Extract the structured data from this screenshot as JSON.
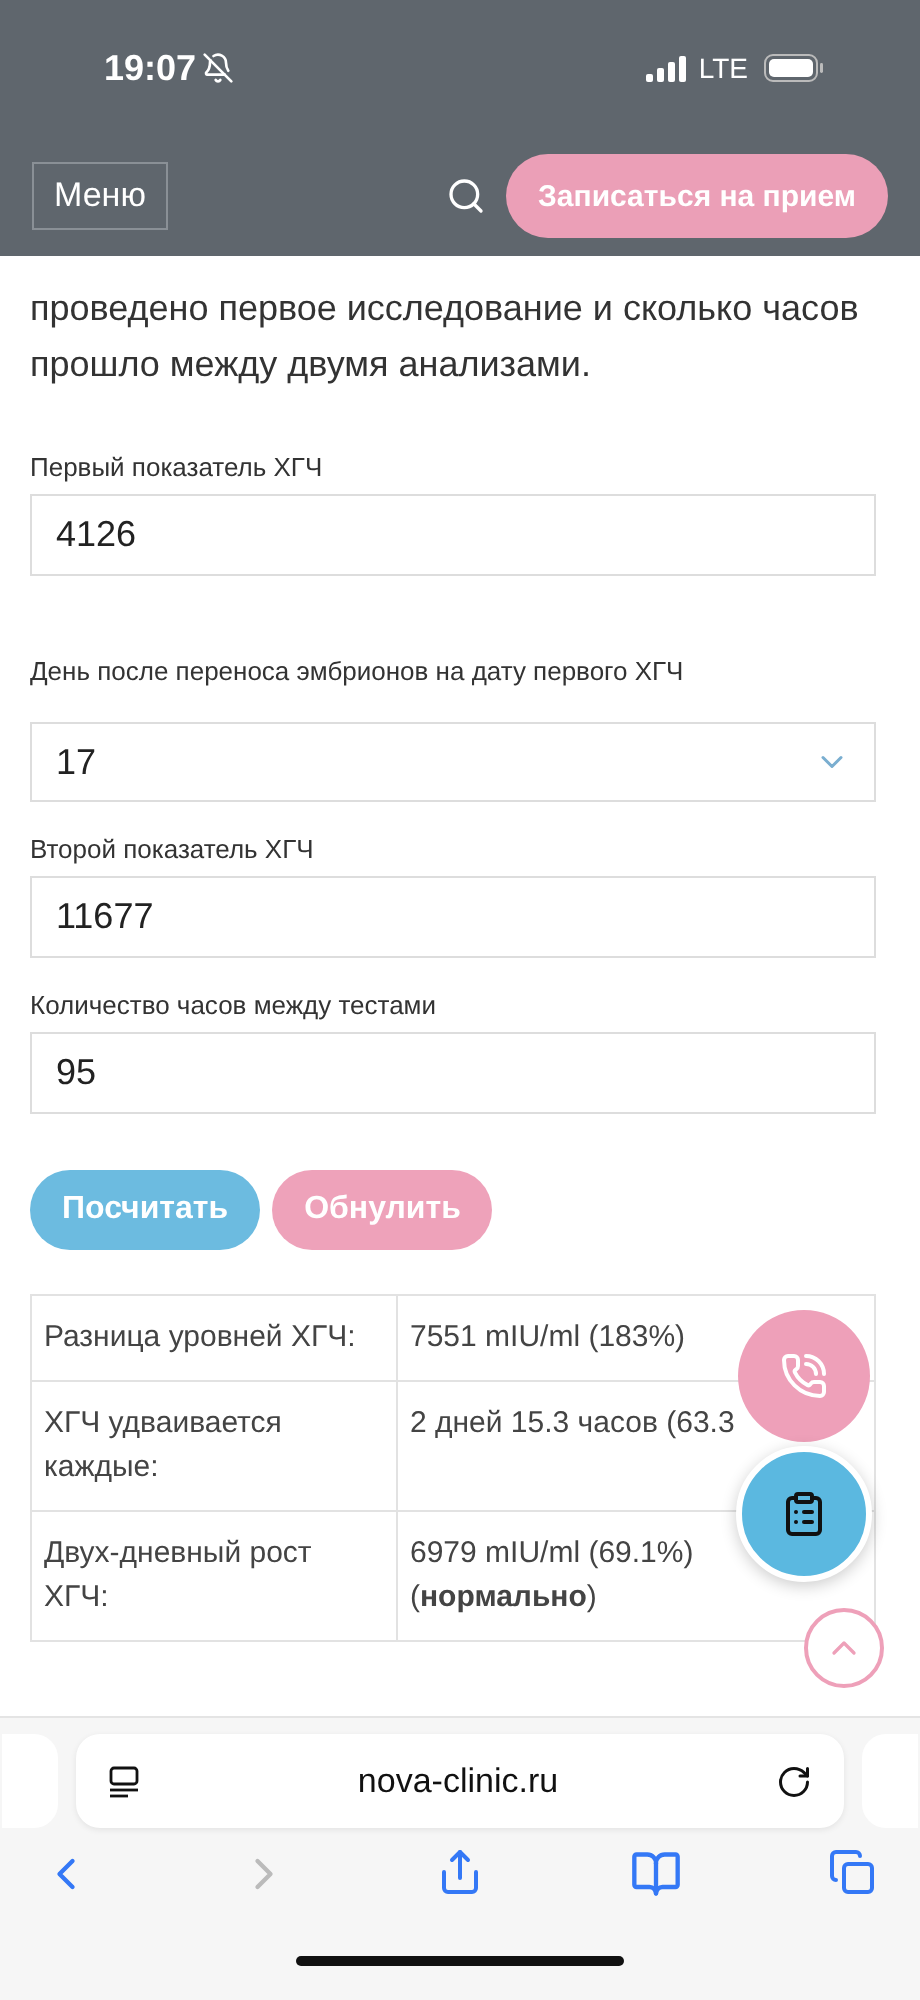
{
  "status_bar": {
    "time": "19:07",
    "network": "LTE",
    "silent": true
  },
  "header": {
    "menu_label": "Меню",
    "cta_label": "Записаться на прием"
  },
  "intro": "проведено первое исследование и сколько часов прошло между двумя анализами.",
  "fields": [
    {
      "kind": "input",
      "label": "Первый показатель ХГЧ",
      "value": "4126"
    },
    {
      "kind": "select",
      "label": "День после переноса эмбрионов на дату первого ХГЧ",
      "value": "17"
    },
    {
      "kind": "input",
      "label": "Второй показатель ХГЧ",
      "value": "11677"
    },
    {
      "kind": "input",
      "label": "Количество часов между тестами",
      "value": "95"
    }
  ],
  "buttons": [
    {
      "label": "Посчитать",
      "kind": "primary"
    },
    {
      "label": "Обнулить",
      "kind": "secondary"
    }
  ],
  "results": [
    {
      "label": "Разница уровней ХГЧ:",
      "value": "7551 mIU/ml (183%)"
    },
    {
      "label": "ХГЧ удваивается каждые:",
      "value": "2 дней 15.3 часов (63.3"
    },
    {
      "label": "Двух-дневный рост ХГЧ:",
      "value": "6979 mIU/ml (69.1%) (**нормально**)"
    }
  ],
  "browser": {
    "url": "nova-clinic.ru"
  }
}
